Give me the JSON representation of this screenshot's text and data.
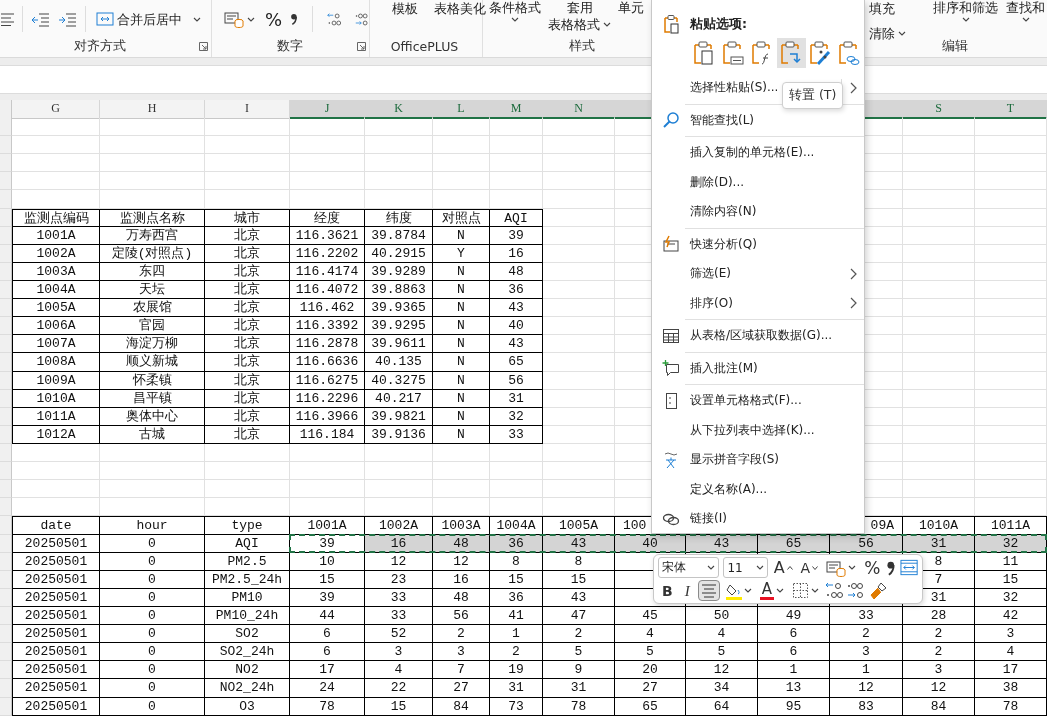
{
  "ribbon": {
    "alignment": {
      "label": "对齐方式",
      "merge_button": "合并后居中"
    },
    "number": {
      "label": "数字",
      "percent": "%"
    },
    "officeplus": {
      "label": "OfficePLUS",
      "buttons": [
        "模板",
        "表格美化"
      ]
    },
    "styles": {
      "label": "样式",
      "buttons": [
        {
          "lines": [
            "条件格式"
          ],
          "dropdown": true
        },
        {
          "lines": [
            "套用",
            "表格格式"
          ],
          "dropdown": true
        },
        {
          "lines": [
            "单元"
          ],
          "dropdown": false
        }
      ]
    },
    "editing": {
      "label": "编辑",
      "columns": [
        [
          {
            "label": "填充",
            "dropdown": false
          },
          {
            "label": "清除",
            "dropdown": true
          }
        ],
        [
          {
            "label": "排序和筛选",
            "dropdown": true
          }
        ],
        [
          {
            "label": "查找和",
            "dropdown": true
          }
        ]
      ]
    }
  },
  "sheet": {
    "columns": [
      {
        "label": "G",
        "selected": false
      },
      {
        "label": "H",
        "selected": false
      },
      {
        "label": "I",
        "selected": false
      },
      {
        "label": "J",
        "selected": true
      },
      {
        "label": "K",
        "selected": true
      },
      {
        "label": "L",
        "selected": true
      },
      {
        "label": "M",
        "selected": true
      },
      {
        "label": "N",
        "selected": true
      },
      {
        "selected": true
      },
      {
        "selected": true
      },
      {
        "label": "S",
        "selected": true
      },
      {
        "label": "T",
        "selected": true
      }
    ],
    "station_table": {
      "header": [
        "监测点编码",
        "监测点名称",
        "城市",
        "经度",
        "纬度",
        "对照点",
        "AQI"
      ],
      "rows": [
        [
          "1001A",
          "万寿西宫",
          "北京",
          "116.3621",
          "39.8784",
          "N",
          "39"
        ],
        [
          "1002A",
          "定陵(对照点)",
          "北京",
          "116.2202",
          "40.2915",
          "Y",
          "16"
        ],
        [
          "1003A",
          "东四",
          "北京",
          "116.4174",
          "39.9289",
          "N",
          "48"
        ],
        [
          "1004A",
          "天坛",
          "北京",
          "116.4072",
          "39.8863",
          "N",
          "36"
        ],
        [
          "1005A",
          "农展馆",
          "北京",
          "116.462",
          "39.9365",
          "N",
          "43"
        ],
        [
          "1006A",
          "官园",
          "北京",
          "116.3392",
          "39.9295",
          "N",
          "40"
        ],
        [
          "1007A",
          "海淀万柳",
          "北京",
          "116.2878",
          "39.9611",
          "N",
          "43"
        ],
        [
          "1008A",
          "顺义新城",
          "北京",
          "116.6636",
          "40.135",
          "N",
          "65"
        ],
        [
          "1009A",
          "怀柔镇",
          "北京",
          "116.6275",
          "40.3275",
          "N",
          "56"
        ],
        [
          "1010A",
          "昌平镇",
          "北京",
          "116.2296",
          "40.217",
          "N",
          "31"
        ],
        [
          "1011A",
          "奥体中心",
          "北京",
          "116.3966",
          "39.9821",
          "N",
          "32"
        ],
        [
          "1012A",
          "古城",
          "北京",
          "116.184",
          "39.9136",
          "N",
          "33"
        ]
      ]
    },
    "data_table": {
      "header": [
        "date",
        "hour",
        "type",
        "1001A",
        "1002A",
        "1003A",
        "1004A",
        "1005A",
        "100",
        "09A",
        "1010A",
        "1011A"
      ],
      "rows": [
        {
          "kind": "full",
          "cells": [
            "20250501",
            "0",
            "AQI",
            "39",
            "16",
            "48",
            "36",
            "43",
            "40",
            "43",
            "65",
            "56",
            "31",
            "32"
          ],
          "selected": true
        },
        {
          "kind": "covered",
          "cells": [
            "20250501",
            "0",
            "PM2.5",
            "10",
            "12",
            "12",
            "8",
            "8",
            "8",
            "11"
          ],
          "selected": false
        },
        {
          "kind": "covered",
          "cells": [
            "20250501",
            "0",
            "PM2.5_24h",
            "15",
            "23",
            "16",
            "15",
            "15",
            "7",
            "15"
          ],
          "selected": false
        },
        {
          "kind": "covered",
          "cells": [
            "20250501",
            "0",
            "PM10",
            "39",
            "33",
            "48",
            "36",
            "43",
            "31",
            "32"
          ],
          "selected": false
        },
        {
          "kind": "full",
          "cells": [
            "20250501",
            "0",
            "PM10_24h",
            "44",
            "33",
            "56",
            "41",
            "47",
            "45",
            "50",
            "49",
            "33",
            "28",
            "42"
          ],
          "selected": false
        },
        {
          "kind": "full",
          "cells": [
            "20250501",
            "0",
            "SO2",
            "6",
            "52",
            "2",
            "1",
            "2",
            "4",
            "4",
            "6",
            "2",
            "2",
            "3"
          ],
          "selected": false
        },
        {
          "kind": "full",
          "cells": [
            "20250501",
            "0",
            "SO2_24h",
            "6",
            "3",
            "3",
            "2",
            "5",
            "5",
            "5",
            "6",
            "3",
            "2",
            "4"
          ],
          "selected": false
        },
        {
          "kind": "full",
          "cells": [
            "20250501",
            "0",
            "NO2",
            "17",
            "4",
            "7",
            "19",
            "9",
            "20",
            "12",
            "1",
            "1",
            "3",
            "17"
          ],
          "selected": false
        },
        {
          "kind": "full",
          "cells": [
            "20250501",
            "0",
            "NO2_24h",
            "24",
            "22",
            "27",
            "31",
            "31",
            "27",
            "34",
            "13",
            "12",
            "12",
            "38"
          ],
          "selected": false
        },
        {
          "kind": "full",
          "cells": [
            "20250501",
            "0",
            "O3",
            "78",
            "15",
            "84",
            "73",
            "78",
            "65",
            "64",
            "95",
            "83",
            "84",
            "78"
          ],
          "selected": false
        }
      ]
    }
  },
  "context_menu": {
    "paste_title": "粘贴选项:",
    "paste_options": [
      {
        "selected": false
      },
      {
        "selected": false
      },
      {
        "selected": false
      },
      {
        "selected": true
      },
      {
        "selected": false
      },
      {
        "selected": false
      }
    ],
    "tooltip": "转置 (T)",
    "sections": [
      [
        {
          "label": "选择性粘贴(S)...",
          "kind": "split"
        }
      ],
      [
        {
          "label": "智能查找(L)",
          "kind": "item"
        }
      ],
      [
        {
          "label": "插入复制的单元格(E)...",
          "kind": "item"
        },
        {
          "label": "删除(D)...",
          "kind": "item"
        },
        {
          "label": "清除内容(N)",
          "kind": "item"
        }
      ],
      [
        {
          "label": "快速分析(Q)",
          "kind": "item"
        },
        {
          "label": "筛选(E)",
          "kind": "submenu"
        },
        {
          "label": "排序(O)",
          "kind": "submenu"
        }
      ],
      [
        {
          "label": "从表格/区域获取数据(G)...",
          "kind": "item"
        }
      ],
      [
        {
          "label": "插入批注(M)",
          "kind": "item"
        }
      ],
      [
        {
          "label": "设置单元格格式(F)...",
          "kind": "item"
        },
        {
          "label": "从下拉列表中选择(K)...",
          "kind": "item"
        },
        {
          "label": "显示拼音字段(S)",
          "kind": "item"
        },
        {
          "label": "定义名称(A)...",
          "kind": "item"
        },
        {
          "label": "链接(I)",
          "kind": "item"
        }
      ]
    ]
  },
  "mini_toolbar": {
    "font": "宋体",
    "size": "11",
    "grow": "A",
    "shrink": "A",
    "percent": "%",
    "bold": "B",
    "italic": "I",
    "font_color": "A",
    "center_align": {
      "selected": true
    }
  }
}
